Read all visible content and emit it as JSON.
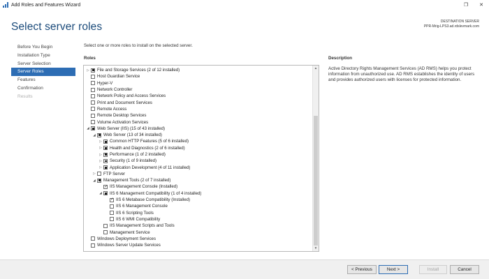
{
  "window": {
    "title": "Add Roles and Features Wizard",
    "restore_glyph": "❐",
    "close_glyph": "✕"
  },
  "header": {
    "page_title": "Select server roles",
    "destination_label": "DESTINATION SERVER",
    "destination_value": "PPR-Mrig-LPS3.ad.rdslevmark.com"
  },
  "nav": {
    "items": [
      {
        "label": "Before You Begin",
        "state": "normal"
      },
      {
        "label": "Installation Type",
        "state": "normal"
      },
      {
        "label": "Server Selection",
        "state": "normal"
      },
      {
        "label": "Server Roles",
        "state": "active"
      },
      {
        "label": "Features",
        "state": "normal"
      },
      {
        "label": "Confirmation",
        "state": "normal"
      },
      {
        "label": "Results",
        "state": "disabled"
      }
    ]
  },
  "main": {
    "instruction": "Select one or more roles to install on the selected server.",
    "roles_heading": "Roles",
    "description_heading": "Description",
    "description_text": "Active Directory Rights Management Services (AD RMS) helps you protect information from unauthorized use. AD RMS establishes the identity of users and provides authorized users with licenses for protected information."
  },
  "roles": [
    {
      "label": "File and Storage Services (2 of 12 installed)",
      "level": 0,
      "expander": "collapsed",
      "check": "partial"
    },
    {
      "label": "Host Guardian Service",
      "level": 0,
      "expander": "none",
      "check": "unchecked"
    },
    {
      "label": "Hyper-V",
      "level": 0,
      "expander": "none",
      "check": "unchecked"
    },
    {
      "label": "Network Controller",
      "level": 0,
      "expander": "none",
      "check": "unchecked"
    },
    {
      "label": "Network Policy and Access Services",
      "level": 0,
      "expander": "none",
      "check": "unchecked"
    },
    {
      "label": "Print and Document Services",
      "level": 0,
      "expander": "none",
      "check": "unchecked"
    },
    {
      "label": "Remote Access",
      "level": 0,
      "expander": "none",
      "check": "unchecked"
    },
    {
      "label": "Remote Desktop Services",
      "level": 0,
      "expander": "none",
      "check": "unchecked"
    },
    {
      "label": "Volume Activation Services",
      "level": 0,
      "expander": "none",
      "check": "unchecked"
    },
    {
      "label": "Web Server (IIS) (15 of 43 installed)",
      "level": 0,
      "expander": "expanded",
      "check": "partial"
    },
    {
      "label": "Web Server (13 of 34 installed)",
      "level": 1,
      "expander": "expanded",
      "check": "partial"
    },
    {
      "label": "Common HTTP Features (5 of 6 installed)",
      "level": 2,
      "expander": "collapsed",
      "check": "partial"
    },
    {
      "label": "Health and Diagnostics (2 of 6 installed)",
      "level": 2,
      "expander": "collapsed",
      "check": "partial"
    },
    {
      "label": "Performance (1 of 2 installed)",
      "level": 2,
      "expander": "collapsed",
      "check": "partial"
    },
    {
      "label": "Security (1 of 9 installed)",
      "level": 2,
      "expander": "collapsed",
      "check": "partial"
    },
    {
      "label": "Application Development (4 of 11 installed)",
      "level": 2,
      "expander": "collapsed",
      "check": "partial"
    },
    {
      "label": "FTP Server",
      "level": 1,
      "expander": "collapsed",
      "check": "unchecked"
    },
    {
      "label": "Management Tools (2 of 7 installed)",
      "level": 1,
      "expander": "expanded",
      "check": "partial"
    },
    {
      "label": "IIS Management Console (Installed)",
      "level": 2,
      "expander": "none",
      "check": "checked"
    },
    {
      "label": "IIS 6 Management Compatibility (1 of 4 installed)",
      "level": 2,
      "expander": "expanded",
      "check": "partial"
    },
    {
      "label": "IIS 6 Metabase Compatibility (Installed)",
      "level": 3,
      "expander": "none",
      "check": "checked"
    },
    {
      "label": "IIS 6 Management Console",
      "level": 3,
      "expander": "none",
      "check": "unchecked"
    },
    {
      "label": "IIS 6 Scripting Tools",
      "level": 3,
      "expander": "none",
      "check": "unchecked"
    },
    {
      "label": "IIS 6 WMI Compatibility",
      "level": 3,
      "expander": "none",
      "check": "unchecked"
    },
    {
      "label": "IIS Management Scripts and Tools",
      "level": 2,
      "expander": "none",
      "check": "unchecked"
    },
    {
      "label": "Management Service",
      "level": 2,
      "expander": "none",
      "check": "unchecked"
    },
    {
      "label": "Windows Deployment Services",
      "level": 0,
      "expander": "none",
      "check": "unchecked"
    },
    {
      "label": "Windows Server Update Services",
      "level": 0,
      "expander": "none",
      "check": "unchecked"
    }
  ],
  "footer": {
    "previous_label": "< Previous",
    "next_label": "Next >",
    "install_label": "Install",
    "cancel_label": "Cancel"
  },
  "colors": {
    "accent": "#2d6db4",
    "title_blue": "#1a4a7a"
  }
}
